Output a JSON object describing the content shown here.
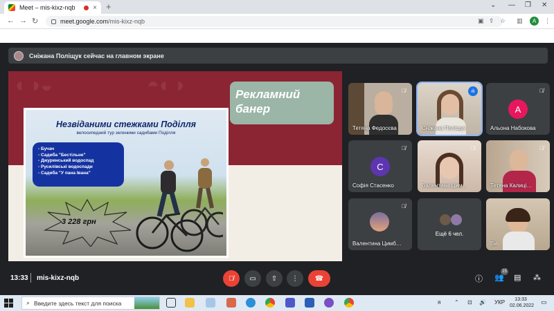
{
  "browser": {
    "tab_title": "Meet – mis-kixz-nqb",
    "tab_close": "×",
    "new_tab": "+",
    "url_domain": "meet.google.com",
    "url_path": "/mis-kixz-nqb",
    "avatar_letter": "A"
  },
  "banner": {
    "text": "Сніжана Поліщук сейчас на главном экране"
  },
  "presentation": {
    "ad_label": "Рекламний банер",
    "poster_title": "Незвіданими стежками Поділля",
    "poster_subtitle": "велосипедний тур зеленими садибами Поділля",
    "poster_items": [
      "Бучач",
      "Садиба \"Бестільне\"",
      "Джуринський водоспад",
      "Русилівські водоспади",
      "Садиба \"У пана Івана\""
    ],
    "price": "3 228 грн"
  },
  "participants": [
    {
      "name": "Тетяна Федосєва",
      "type": "video"
    },
    {
      "name": "Сніжана Поліщук",
      "type": "video",
      "speaking": true
    },
    {
      "name": "Альона Набокова",
      "type": "avatar",
      "letter": "А",
      "color": "#e8175d"
    },
    {
      "name": "Софія Стасенко",
      "type": "avatar",
      "letter": "С",
      "color": "#5e35b1"
    },
    {
      "name": "Валентина Цим…",
      "type": "video"
    },
    {
      "name": "Тетяна Калиці…",
      "type": "video"
    },
    {
      "name": "Валентина Цимб…",
      "type": "image"
    },
    {
      "name": "Ещё 6 чел.",
      "type": "more"
    },
    {
      "name": "Ви",
      "type": "video"
    }
  ],
  "meeting": {
    "time": "13:33",
    "code": "mis-kixz-nqb",
    "people_count": "15"
  },
  "taskbar": {
    "search_placeholder": "Введите здесь текст для поиска",
    "lang": "УКР",
    "time": "13:33",
    "date": "02.06.2022"
  },
  "colors": {
    "meet_bg": "#202124",
    "tile_bg": "#3c4043",
    "hangup_red": "#ea4335",
    "slide_red": "#8c2533"
  }
}
